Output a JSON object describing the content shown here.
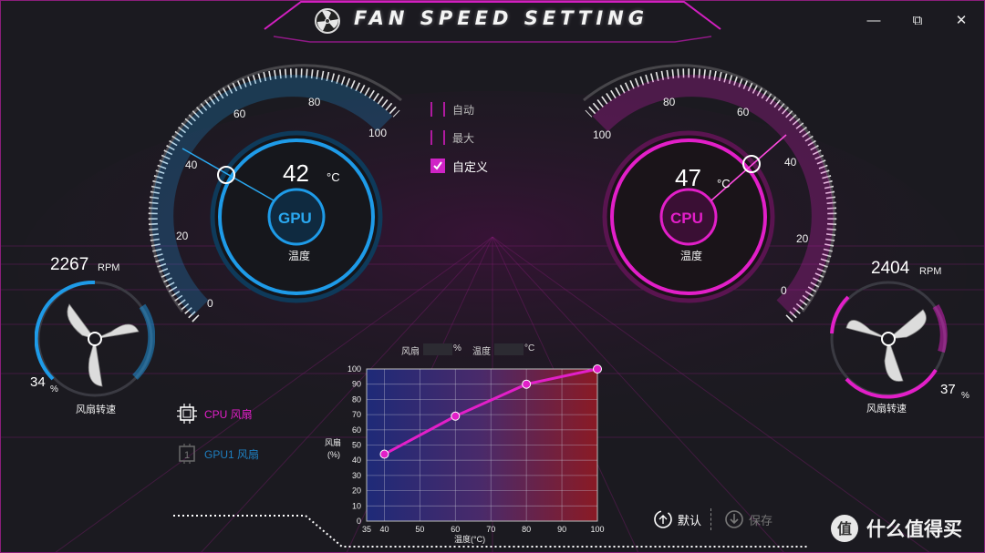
{
  "window": {
    "title": "FAN SPEED SETTING",
    "minimize_symbol": "—",
    "restore_symbol": "⧉",
    "close_symbol": "✕"
  },
  "gpu_gauge": {
    "label": "GPU",
    "temperature": "42",
    "unit": "°C",
    "caption": "温度",
    "ticks": [
      "0",
      "20",
      "40",
      "60",
      "80",
      "100"
    ],
    "accent": "#1e9be8"
  },
  "cpu_gauge": {
    "label": "CPU",
    "temperature": "47",
    "unit": "°C",
    "caption": "温度",
    "ticks": [
      "100",
      "80",
      "60",
      "40",
      "20",
      "0"
    ],
    "accent": "#e21fc8"
  },
  "modes": [
    {
      "label": "自动",
      "checked": false
    },
    {
      "label": "最大",
      "checked": false
    },
    {
      "label": "自定义",
      "checked": true
    }
  ],
  "left_fan": {
    "rpm": "2267",
    "rpm_unit": "RPM",
    "percent": "34",
    "percent_unit": "%",
    "caption": "风扇转速",
    "accent": "#1e9be8"
  },
  "right_fan": {
    "rpm": "2404",
    "rpm_unit": "RPM",
    "percent": "37",
    "percent_unit": "%",
    "caption": "风扇转速",
    "accent": "#e21fc8"
  },
  "fan_select": [
    {
      "label": "CPU 风扇",
      "active": true,
      "color": "#e21fc8"
    },
    {
      "label": "GPU1 风扇",
      "active": false,
      "color": "#1e7fc0"
    }
  ],
  "curve_inputs": {
    "fan_label": "风扇",
    "fan_value": "",
    "fan_unit": "%",
    "temp_label": "温度",
    "temp_value": "",
    "temp_unit": "°C"
  },
  "chart_data": {
    "type": "line",
    "xlabel": "温度(°C)",
    "ylabel": "风扇 (%)",
    "ylabel_line1": "风扇",
    "ylabel_line2": "(%)",
    "xlim": [
      35,
      100
    ],
    "ylim": [
      0,
      100
    ],
    "xticks": [
      35,
      40,
      50,
      60,
      70,
      80,
      90,
      100
    ],
    "yticks": [
      0,
      10,
      20,
      30,
      40,
      50,
      60,
      70,
      80,
      90,
      100
    ],
    "grid": true,
    "series": [
      {
        "x": [
          40,
          60,
          80,
          100
        ],
        "y": [
          44,
          69,
          90,
          100
        ],
        "color": "#e21fc8"
      }
    ]
  },
  "buttons": {
    "default_label": "默认",
    "save_label": "保存"
  },
  "watermark": "什么值得买"
}
